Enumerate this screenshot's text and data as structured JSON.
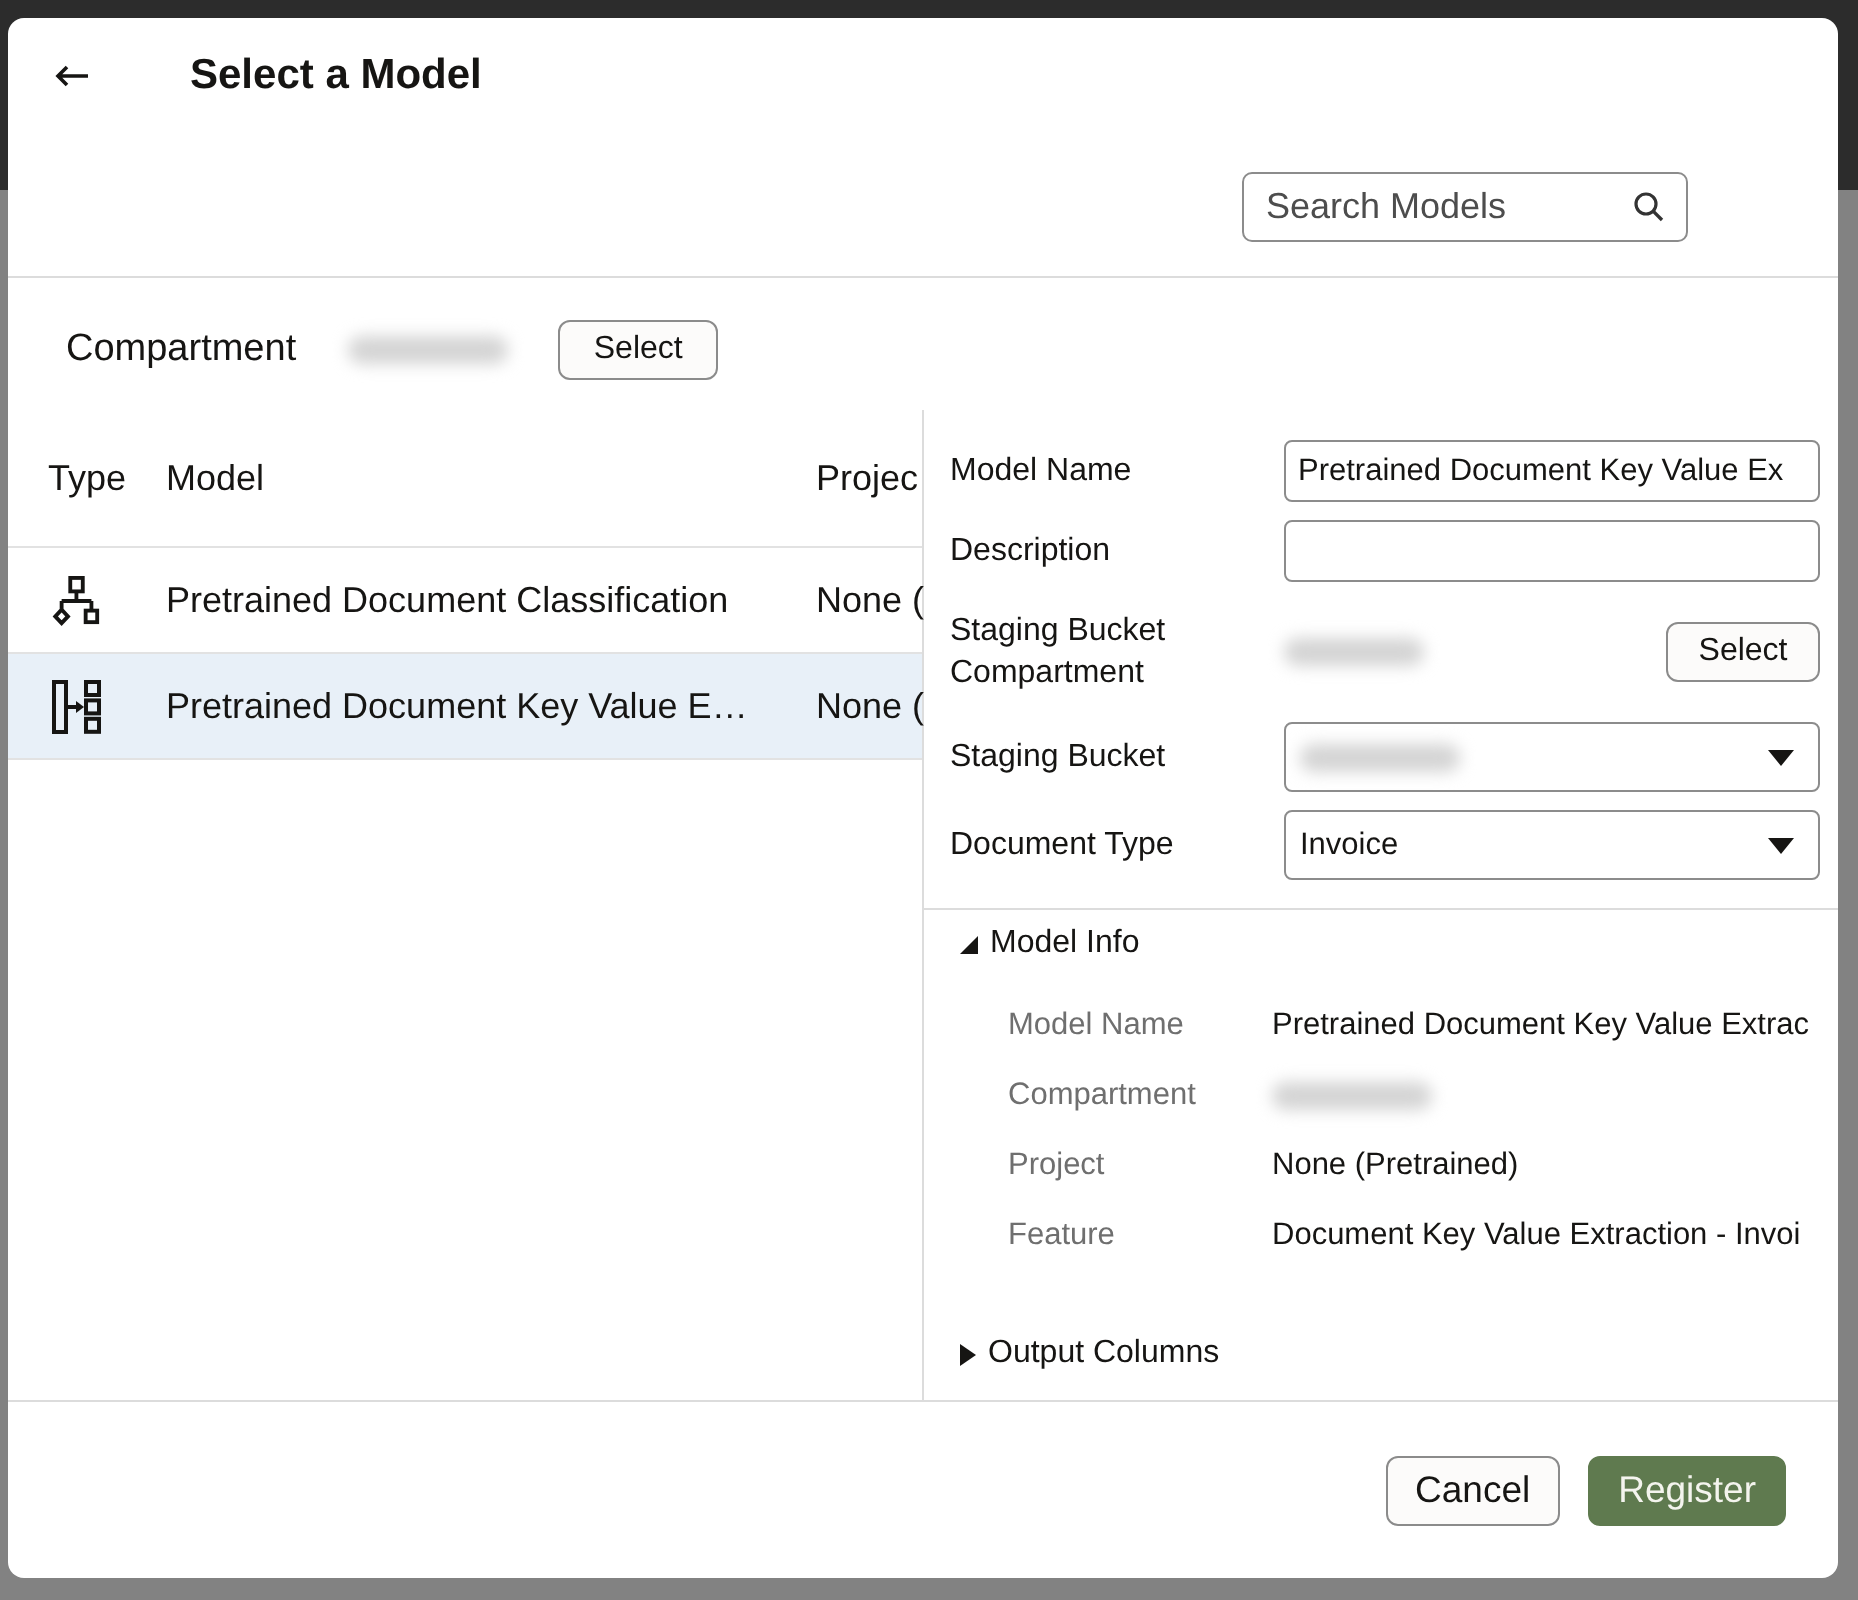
{
  "dialog": {
    "title": "Select a Model",
    "search": {
      "placeholder": "Search Models"
    }
  },
  "compartment": {
    "label": "Compartment",
    "blurred": true,
    "button": "Select"
  },
  "table": {
    "columns": [
      "Type",
      "Model",
      "Projec"
    ],
    "rows": [
      {
        "kind": "classification",
        "model": "Pretrained Document Classification",
        "project": "None (",
        "selected": false
      },
      {
        "kind": "extraction",
        "model": "Pretrained Document Key Value E…",
        "project": "None (",
        "selected": true
      }
    ]
  },
  "form": {
    "fields": [
      {
        "kind": "input",
        "label": "Model Name",
        "value": "Pretrained Document Key Value Ex"
      },
      {
        "kind": "input",
        "label": "Description"
      },
      {
        "kind": "picker",
        "label": "Staging Bucket Compartment",
        "blurred": true,
        "button": "Select"
      },
      {
        "kind": "dropdown",
        "label": "Staging Bucket",
        "blurred": true
      },
      {
        "kind": "dropdown",
        "label": "Document Type",
        "value": "Invoice"
      }
    ]
  },
  "sections": [
    {
      "title": "Model Info",
      "expanded": true,
      "rows": [
        {
          "label": "Model Name",
          "kind": "text",
          "value": "Pretrained Document Key Value Extrac"
        },
        {
          "label": "Compartment",
          "kind": "blurred"
        },
        {
          "label": "Project",
          "kind": "text",
          "value": "None (Pretrained)"
        },
        {
          "label": "Feature",
          "kind": "text",
          "value": "Document Key Value Extraction - Invoi"
        }
      ]
    },
    {
      "title": "Output Columns",
      "expanded": false
    }
  ],
  "buttons": [
    {
      "label": "Cancel",
      "kind": "secondary"
    },
    {
      "label": "Register",
      "kind": "primary"
    }
  ]
}
